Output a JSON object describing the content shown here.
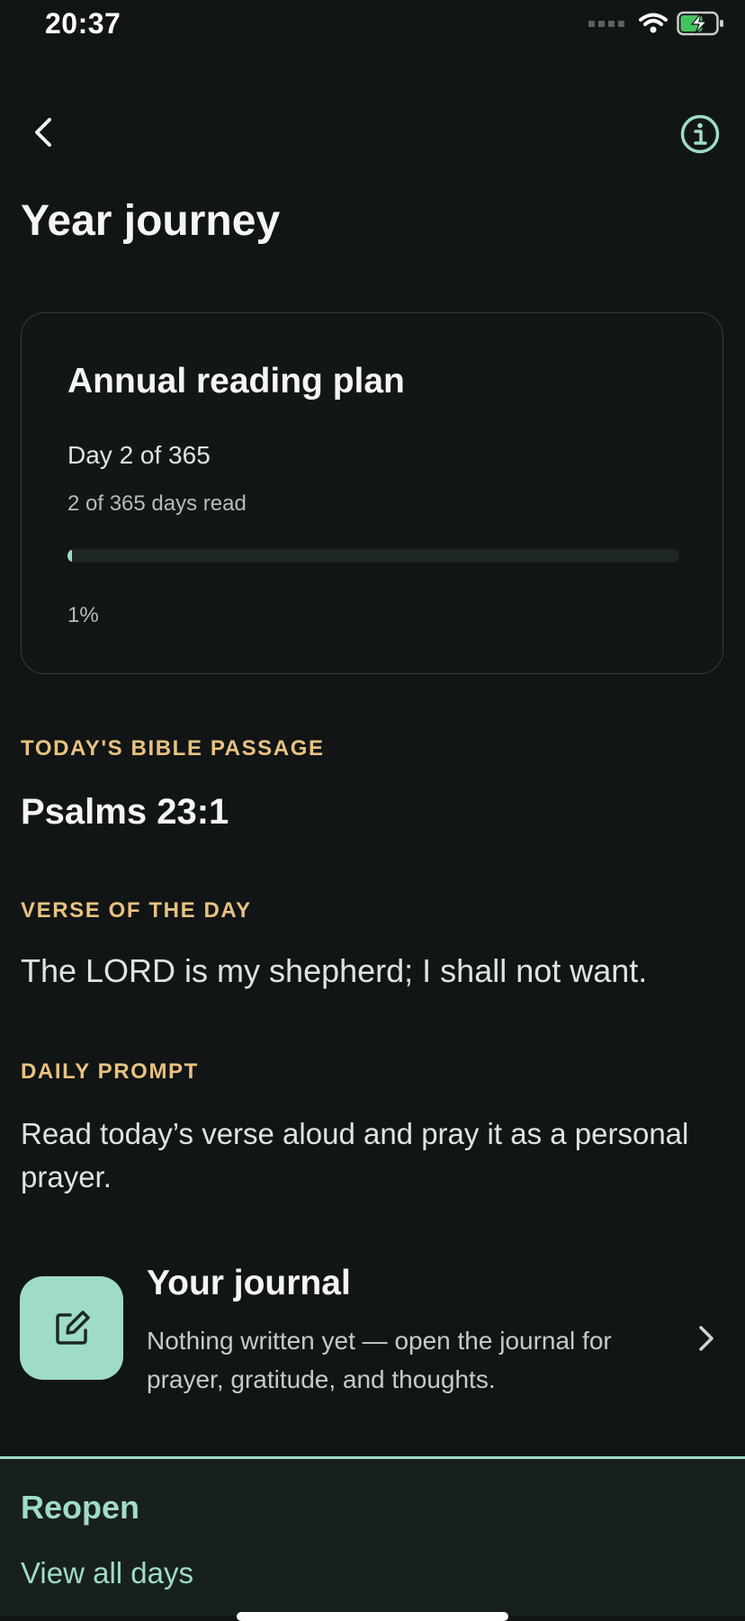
{
  "status_bar": {
    "time": "20:37",
    "icons": [
      "signal-icon",
      "wifi-icon",
      "battery-charging-icon"
    ]
  },
  "nav": {
    "back_icon": "chevron-left-icon",
    "info_icon": "info-icon"
  },
  "page": {
    "title": "Year journey"
  },
  "plan": {
    "title": "Annual reading plan",
    "day_label": "Day 2 of 365",
    "read_label": "2 of 365 days read",
    "progress_fraction": 0.005,
    "percent_label": "1%"
  },
  "today": {
    "passage_label": "TODAY'S BIBLE PASSAGE",
    "passage": "Psalms 23:1",
    "verse_label": "VERSE OF THE DAY",
    "verse": "The LORD is my shepherd; I shall not want.",
    "prompt_label": "DAILY PROMPT",
    "prompt": "Read today’s verse aloud and pray it as a personal prayer."
  },
  "journal": {
    "icon": "edit-icon",
    "title": "Your journal",
    "description": "Nothing written yet — open the journal for prayer, gratitude, and thoughts."
  },
  "bottom": {
    "title": "Reopen",
    "link": "View all days"
  },
  "colors": {
    "background": "#121515",
    "accent": "#9fdcc6",
    "label_gold": "#e8c281"
  }
}
